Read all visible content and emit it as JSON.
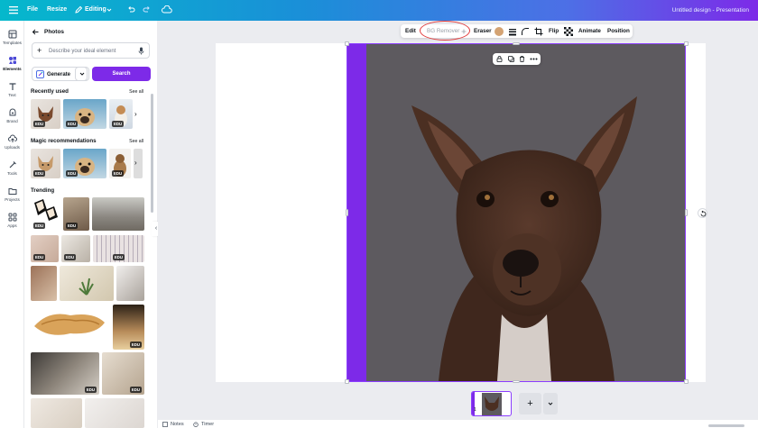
{
  "topbar": {
    "file_label": "File",
    "resize_label": "Resize",
    "editing_label": "Editing",
    "doc_title": "Untitled design - Presentation"
  },
  "rail": {
    "items": [
      {
        "label": "Templates",
        "icon": "templates-icon"
      },
      {
        "label": "Elements",
        "icon": "elements-icon"
      },
      {
        "label": "Text",
        "icon": "text-icon"
      },
      {
        "label": "Brand",
        "icon": "brand-icon"
      },
      {
        "label": "Uploads",
        "icon": "uploads-icon"
      },
      {
        "label": "Tools",
        "icon": "tools-icon"
      },
      {
        "label": "Projects",
        "icon": "projects-icon"
      },
      {
        "label": "Apps",
        "icon": "apps-icon"
      }
    ]
  },
  "panel": {
    "title": "Photos",
    "search_placeholder": "Describe your ideal element",
    "generate_label": "Generate",
    "search_label": "Search",
    "recently_used": {
      "title": "Recently used",
      "see_all": "See all"
    },
    "magic": {
      "title": "Magic recommendations",
      "see_all": "See all"
    },
    "trending": {
      "title": "Trending"
    },
    "badge": "EDU"
  },
  "context_toolbar": {
    "edit": "Edit",
    "bg_remover": "BG Remover",
    "eraser": "Eraser",
    "flip": "Flip",
    "animate": "Animate",
    "position": "Position",
    "color_swatch": "#d4a373"
  },
  "pages": {
    "current": "1"
  },
  "footer": {
    "notes": "Notes",
    "timer": "Timer"
  },
  "colors": {
    "accent": "#7d2ae8",
    "highlight": "#e23c3c"
  }
}
